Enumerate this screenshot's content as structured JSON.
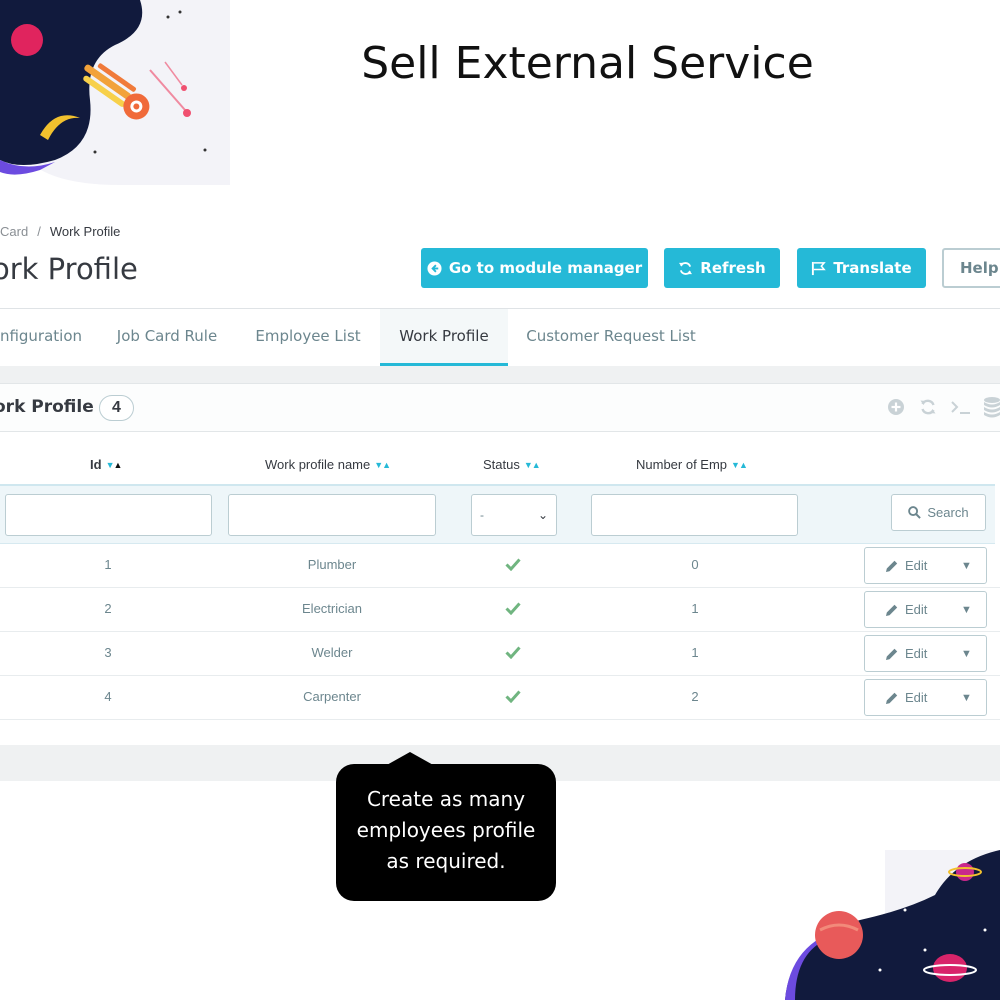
{
  "promo": {
    "title": "Sell External Service"
  },
  "breadcrumb": {
    "parent": "Card",
    "separator": "/",
    "current": "Work Profile"
  },
  "page": {
    "title": "ork Profile"
  },
  "toolbar": {
    "module_manager": "Go to module manager",
    "refresh": "Refresh",
    "translate": "Translate",
    "help": "Help"
  },
  "tabs": [
    {
      "label": "nfiguration",
      "active": false
    },
    {
      "label": "Job Card Rule",
      "active": false
    },
    {
      "label": "Employee List",
      "active": false
    },
    {
      "label": "Work Profile",
      "active": true
    },
    {
      "label": "Customer Request List",
      "active": false
    }
  ],
  "panel": {
    "title": "ork Profile",
    "count": "4",
    "header_icons": [
      "add-icon",
      "refresh-icon",
      "terminal-icon",
      "database-icon"
    ]
  },
  "table": {
    "columns": [
      "Id",
      "Work profile name",
      "Status",
      "Number of Emp"
    ],
    "status_filter": "-",
    "search_label": "Search",
    "edit_label": "Edit",
    "rows": [
      {
        "id": "1",
        "name": "Plumber",
        "status": "enabled",
        "employees": "0"
      },
      {
        "id": "2",
        "name": "Electrician",
        "status": "enabled",
        "employees": "1"
      },
      {
        "id": "3",
        "name": "Welder",
        "status": "enabled",
        "employees": "1"
      },
      {
        "id": "4",
        "name": "Carpenter",
        "status": "enabled",
        "employees": "2"
      }
    ]
  },
  "tooltip": {
    "lines": [
      "Create as many",
      "employees profile",
      "as required."
    ]
  },
  "colors": {
    "accent": "#25b9d7",
    "success": "#70b580",
    "text": "#363a41",
    "muted": "#6c868e"
  }
}
